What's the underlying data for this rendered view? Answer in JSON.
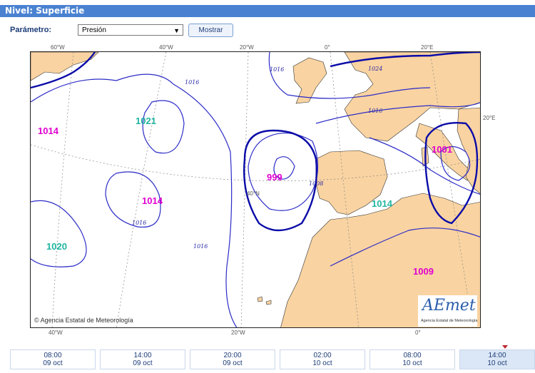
{
  "header": {
    "title": "Nivel: Superficie"
  },
  "controls": {
    "parameter_label": "Parámetro:",
    "parameter_value": "Presión",
    "show_button": "Mostrar"
  },
  "map": {
    "longitude_labels_top": [
      "60°W",
      "40°W",
      "20°W",
      "0°",
      "20°E"
    ],
    "longitude_labels_bottom": [
      "40°W",
      "20°W",
      "0°"
    ],
    "latitude_labels": [
      "40°N",
      "20°E"
    ],
    "pressure_centers": [
      {
        "value": "1014",
        "color": "#e000d0"
      },
      {
        "value": "1021",
        "color": "#20b5a0"
      },
      {
        "value": "999",
        "color": "#e000d0"
      },
      {
        "value": "1014",
        "color": "#e000d0"
      },
      {
        "value": "1020",
        "color": "#20b5a0"
      },
      {
        "value": "1001",
        "color": "#e000d0"
      },
      {
        "value": "1014",
        "color": "#20b5a0"
      },
      {
        "value": "1009",
        "color": "#e000d0"
      }
    ],
    "isobar_labels": [
      "1016",
      "1016",
      "1024",
      "1016",
      "1016",
      "1016",
      "1008"
    ],
    "copyright": "Agencia Estatal de Meteorología",
    "logo_text": "AEmet",
    "logo_subtitle": "Agencia Estatal de Meteorología",
    "colors": {
      "land": "#f9d3a1",
      "sea": "#ffffff",
      "isobar": "#2c2cc8",
      "header": "#4a82d1"
    }
  },
  "timeline": [
    {
      "time": "08:00",
      "date": "09 oct"
    },
    {
      "time": "14:00",
      "date": "09 oct"
    },
    {
      "time": "20:00",
      "date": "09 oct"
    },
    {
      "time": "02:00",
      "date": "10 oct"
    },
    {
      "time": "08:00",
      "date": "10 oct"
    },
    {
      "time": "14:00",
      "date": "10 oct"
    }
  ]
}
